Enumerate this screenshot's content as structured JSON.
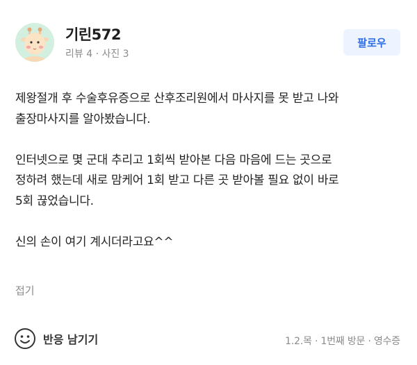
{
  "profile": {
    "username": "기린572",
    "meta": "리뷰 4 · 사진 3"
  },
  "follow_label": "팔로우",
  "review": {
    "paragraphs": [
      [
        "제왕절개 후 수술후유증으로 산후조리원에서 마사지를 못 받고 나와",
        "출장마사지를 알아봤습니다."
      ],
      [
        "인터넷으로 몇 군대 추리고 1회씩 받아본 다음 마음에 드는 곳으로",
        "정하려 했는데 새로 맘케어 1회 받고 다른 곳 받아볼 필요 없이 바로",
        "5회 끊었습니다."
      ],
      [
        "신의 손이 여기 계시더라고요^^"
      ]
    ]
  },
  "collapse_label": "접기",
  "reaction_label": "반응 남기기",
  "visit_info": "1.2.목 · 1번째 방문 · 영수증",
  "icons": {
    "avatar": "giraffe-avatar-icon",
    "reaction": "smiley-icon"
  }
}
